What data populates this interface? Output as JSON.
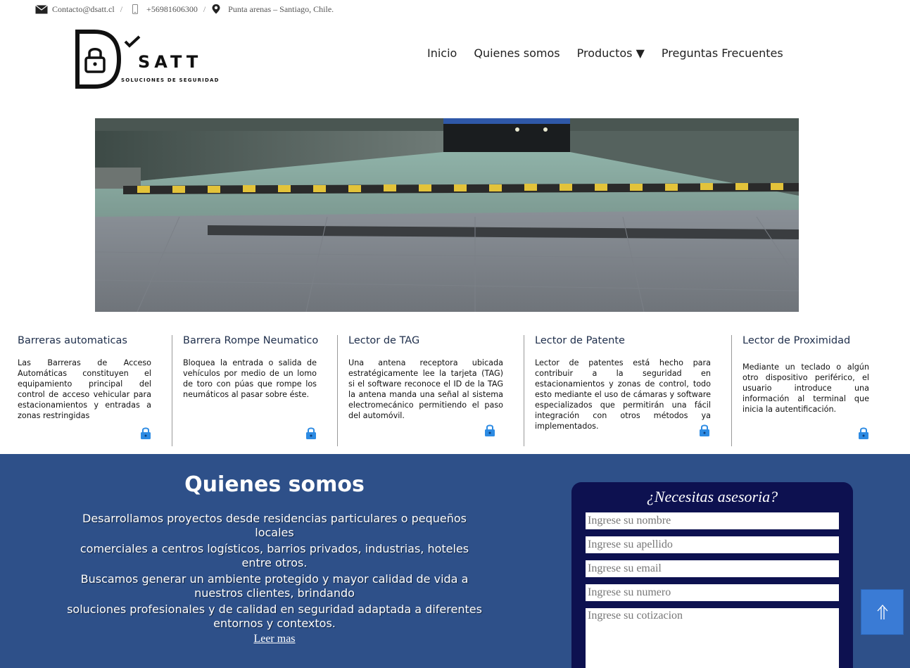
{
  "contact": {
    "email": "Contacto@dsatt.cl",
    "sep1": "/",
    "phone": "+56981606300",
    "sep2": "/",
    "location": "Punta arenas – Santiago, Chile."
  },
  "logo": {
    "brand": "SATT",
    "tagline": "SOLUCIONES DE SEGURIDAD"
  },
  "nav": {
    "items": [
      "Inicio",
      "Quienes somos",
      "Productos ▼",
      "Preguntas Frecuentes"
    ]
  },
  "cards": [
    {
      "title": "Barreras automaticas",
      "text": "Las Barreras de Acceso Automáticas constituyen el equipamiento principal del control de acceso vehicular para estacionamientos y entradas a zonas restringidas"
    },
    {
      "title": "Barrera Rompe Neumatico",
      "text": "Bloquea la entrada o salida de vehículos por medio de un lomo de toro con púas que rompe los neumáticos al pasar sobre éste."
    },
    {
      "title": "Lector de TAG",
      "text": "Una antena receptora ubicada estratégicamente lee la tarjeta (TAG) si el software reconoce el ID de la TAG la antena manda una señal al sistema electromecánico permitiendo el paso del automóvil."
    },
    {
      "title": "Lector de Patente",
      "text": "Lector de patentes está hecho para contribuir a la seguridad en estacionamientos y zonas de control, todo esto mediante el uso de cámaras y software especializados que permitirán una fácil integración con otros métodos ya implementados."
    },
    {
      "title": "Lector de Proximidad",
      "text": "Mediante un teclado o algún otro dispositivo periférico, el usuario introduce una información al terminal que inicia la autentificación."
    }
  ],
  "about": {
    "title": "Quienes somos",
    "lines": [
      "Desarrollamos proyectos desde residencias particulares o pequeños locales",
      "comerciales a centros logísticos, barrios privados, industrias, hoteles entre otros.",
      "Buscamos generar un ambiente protegido y mayor calidad de vida a nuestros clientes, brindando",
      "soluciones profesionales y de calidad en seguridad adaptada a diferentes entornos y contextos."
    ],
    "more": "Leer mas"
  },
  "form": {
    "title": "¿Necesitas asesoria?",
    "name_placeholder": "Ingrese su nombre",
    "lastname_placeholder": "Ingrese su apellido",
    "email_placeholder": "Ingrese su email",
    "phone_placeholder": "Ingrese su numero",
    "quote_placeholder": "Ingrese su cotizacion"
  },
  "colors": {
    "section_blue": "#2e5089",
    "form_navy": "#0d1150",
    "scroll_button": "#3a7bd5",
    "lock_blue": "#2d8be3"
  },
  "icons": [
    "envelope-icon",
    "phone-icon",
    "location-pin-icon",
    "padlock-icon",
    "checkmark-icon",
    "arrow-up-icon"
  ]
}
